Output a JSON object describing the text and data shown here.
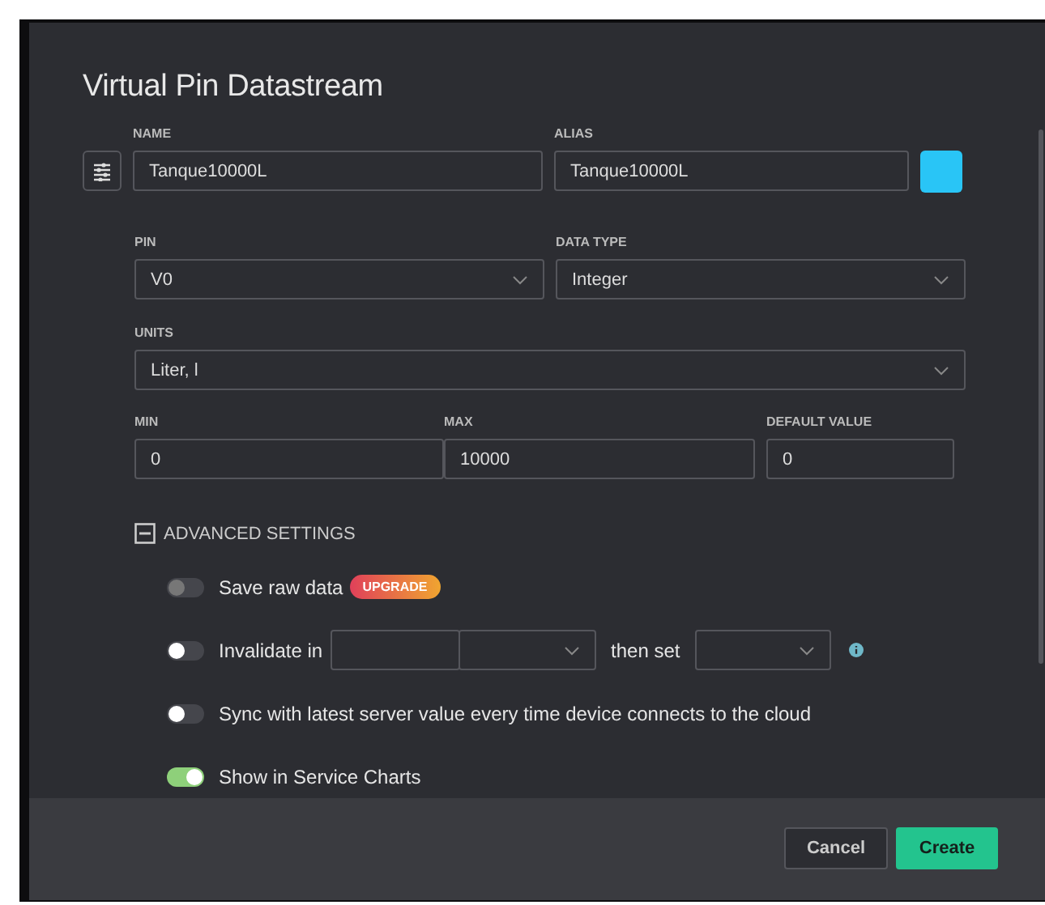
{
  "dialog": {
    "title": "Virtual Pin Datastream"
  },
  "name": {
    "label": "NAME",
    "value": "Tanque10000L"
  },
  "alias": {
    "label": "ALIAS",
    "value": "Tanque10000L",
    "color": "#29c5f6"
  },
  "pin": {
    "label": "PIN",
    "value": "V0"
  },
  "data_type": {
    "label": "DATA TYPE",
    "value": "Integer"
  },
  "units": {
    "label": "UNITS",
    "value": "Liter, l"
  },
  "min": {
    "label": "MIN",
    "value": "0"
  },
  "max": {
    "label": "MAX",
    "value": "10000"
  },
  "default_value": {
    "label": "DEFAULT VALUE",
    "value": "0"
  },
  "advanced": {
    "label": "ADVANCED SETTINGS",
    "expanded": true,
    "options": [
      {
        "kind": "toggle",
        "label": "Save raw data",
        "on": false,
        "disabled": true,
        "badge": "UPGRADE"
      },
      {
        "kind": "invalidate",
        "label": "Invalidate in",
        "then_label": "then set",
        "on": false,
        "disabled": false
      },
      {
        "kind": "toggle",
        "label": "Sync with latest server value every time device connects to the cloud",
        "on": false,
        "disabled": false
      },
      {
        "kind": "toggle",
        "label": "Show in Service Charts",
        "on": true,
        "disabled": false
      }
    ]
  },
  "buttons": [
    {
      "label": "Cancel",
      "kind": "secondary"
    },
    {
      "label": "Create",
      "kind": "primary"
    }
  ]
}
